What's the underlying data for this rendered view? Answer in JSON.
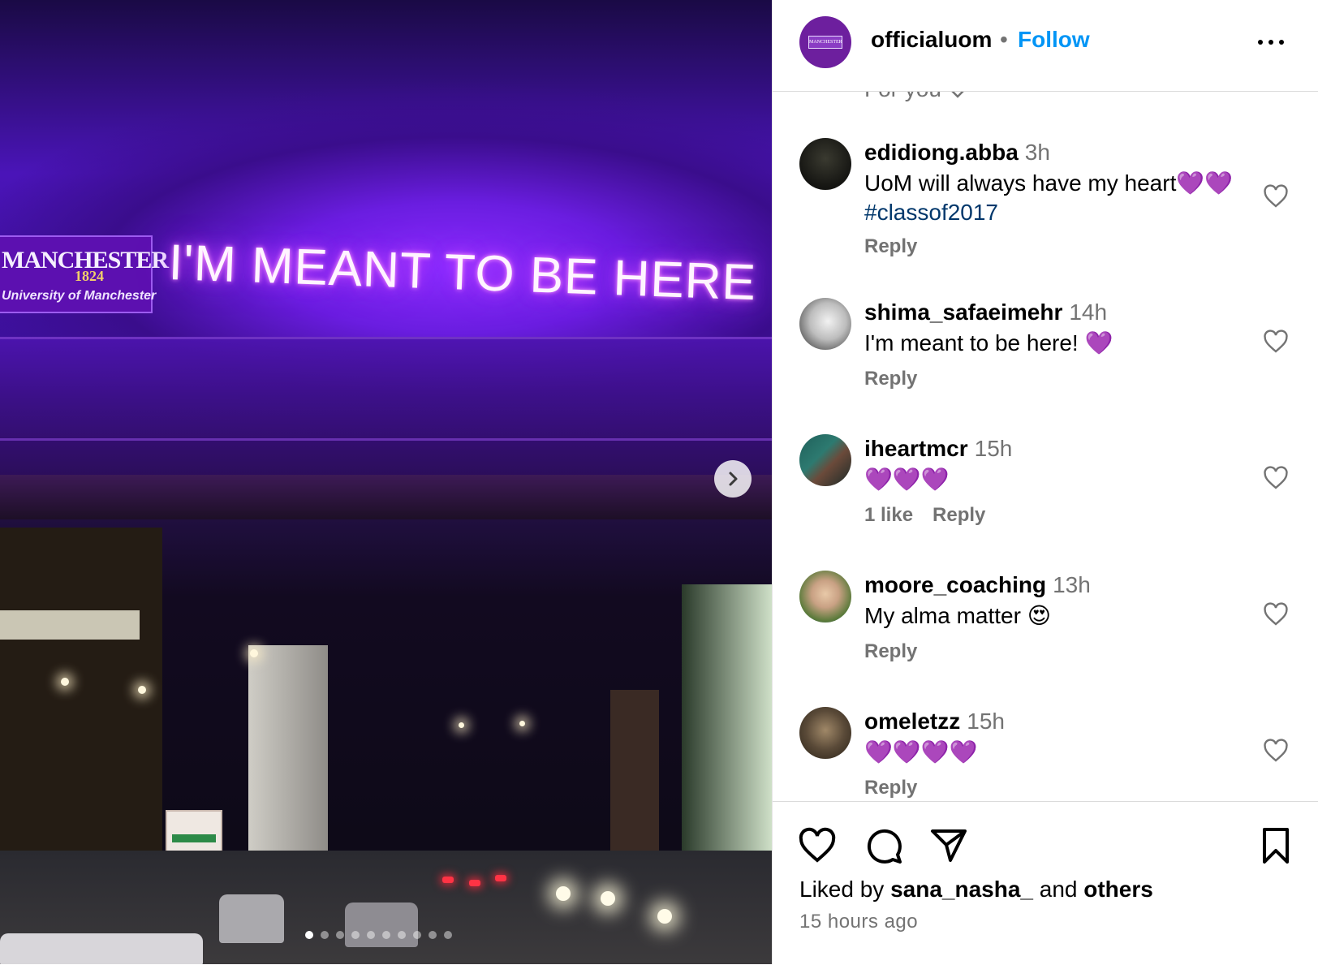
{
  "post_image": {
    "logo_title": "MANCHESTER",
    "logo_year": "1824",
    "logo_subtitle": "University of Manchester",
    "neon_text": "I'M MEANT TO BE HERE",
    "next_icon": "chevron-right-icon",
    "carousel": {
      "count": 10,
      "active_index": 0
    }
  },
  "header": {
    "avatar_text": "MANCHESTER",
    "username": "officialuom",
    "separator": "•",
    "follow_label": "Follow",
    "more_icon": "more-horizontal-icon"
  },
  "comments_header": {
    "label": "For you"
  },
  "comments": [
    {
      "username": "edidiong.abba",
      "time": "3h",
      "text": "UoM will always have my heart💜💜",
      "hashtag": "#classof2017",
      "likes": "",
      "reply": "Reply"
    },
    {
      "username": "shima_safaeimehr",
      "time": "14h",
      "text": "I'm meant to be here! 💜",
      "likes": "",
      "reply": "Reply"
    },
    {
      "username": "iheartmcr",
      "time": "15h",
      "text": "💜💜💜",
      "likes": "1 like",
      "reply": "Reply"
    },
    {
      "username": "moore_coaching",
      "time": "13h",
      "text": "My alma matter 😍",
      "likes": "",
      "reply": "Reply"
    },
    {
      "username": "omeletzz",
      "time": "15h",
      "text": "💜💜💜💜",
      "likes": "",
      "reply": "Reply"
    }
  ],
  "footer": {
    "liked_by_prefix": "Liked by",
    "liked_by_user": "sana_nasha_",
    "liked_by_and": "and",
    "liked_by_others": "others",
    "time_ago": "15 hours ago",
    "icons": [
      "heart-icon",
      "comment-icon",
      "share-icon",
      "bookmark-icon"
    ]
  },
  "colors": {
    "accent": "#0095f6",
    "muted": "#737373",
    "hashtag": "#00376b"
  }
}
